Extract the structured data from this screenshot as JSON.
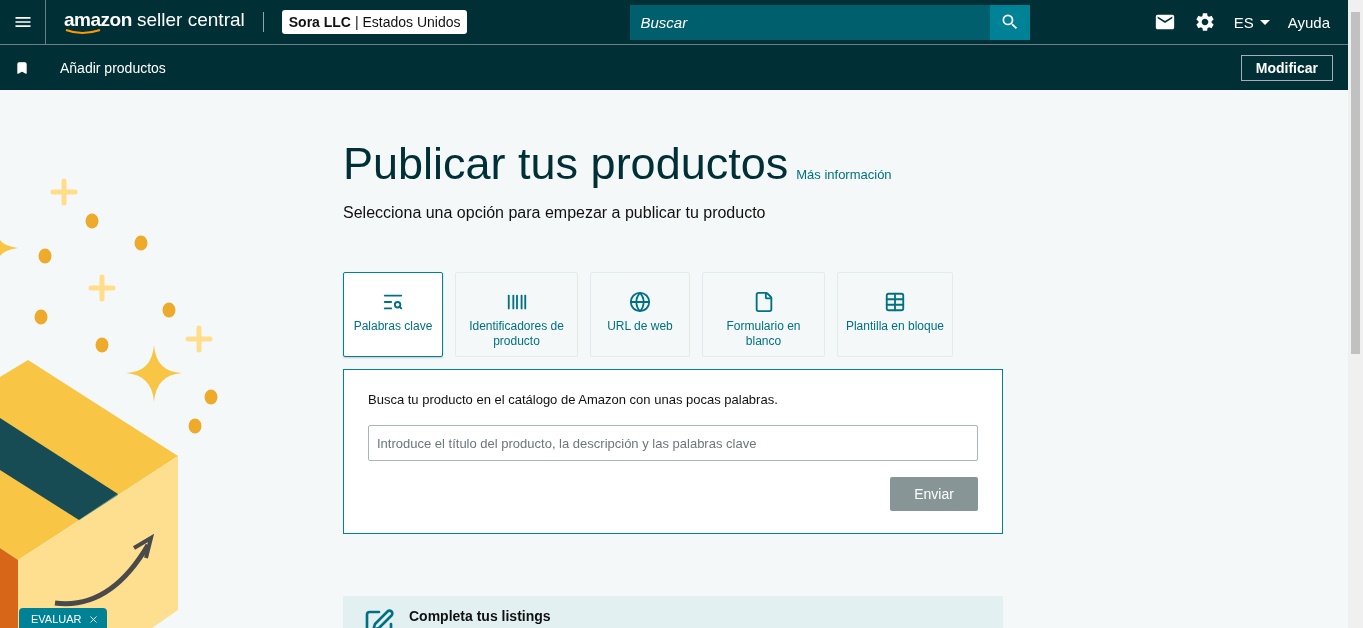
{
  "topbar": {
    "logo_word": "amazon",
    "logo_rest": "seller central",
    "account_name": "Sora LLC",
    "account_separator": "|",
    "account_region": "Estados Unidos",
    "search": {
      "placeholder": "Buscar"
    },
    "language": "ES",
    "help": "Ayuda"
  },
  "subbar": {
    "title": "Añadir productos",
    "edit_button": "Modificar"
  },
  "page": {
    "title": "Publicar tus productos",
    "more_link": "Más información",
    "subtitle": "Selecciona una opción para empezar a publicar tu producto"
  },
  "tabs": [
    {
      "label": "Palabras clave",
      "selected": true
    },
    {
      "label": "Identificadores de producto",
      "selected": false
    },
    {
      "label": "URL de web",
      "selected": false
    },
    {
      "label": "Formulario en blanco",
      "selected": false
    },
    {
      "label": "Plantilla en bloque",
      "selected": false
    }
  ],
  "panel": {
    "instruction": "Busca tu producto en el catálogo de Amazon con unas pocas palabras.",
    "field": {
      "placeholder": "Introduce el título del producto, la descripción y las palabras clave"
    },
    "submit": {
      "label": "Enviar",
      "disabled": true
    }
  },
  "listings_card": {
    "title": "Completa tus listings"
  },
  "feedback_badge": "EVALUAR"
}
